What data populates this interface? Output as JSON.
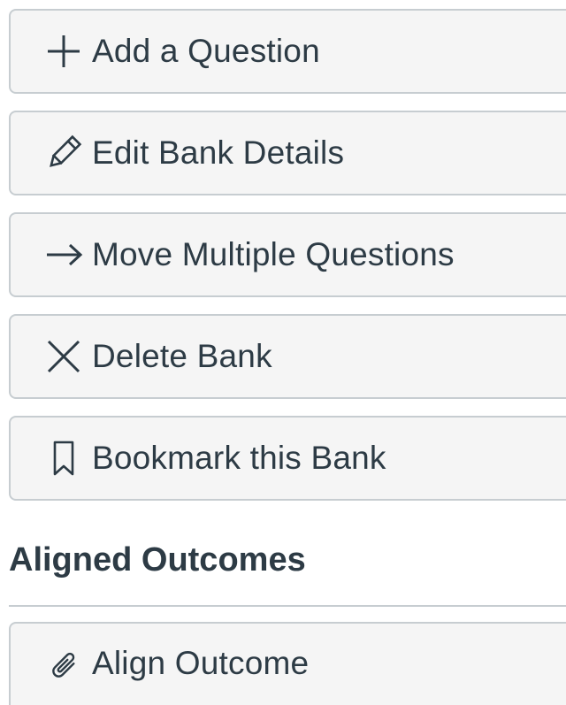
{
  "actions": {
    "add_question": {
      "label": "Add a Question",
      "icon": "plus-icon"
    },
    "edit_bank": {
      "label": "Edit Bank Details",
      "icon": "pencil-icon"
    },
    "move_questions": {
      "label": "Move Multiple Questions",
      "icon": "arrow-right-icon"
    },
    "delete_bank": {
      "label": "Delete Bank",
      "icon": "x-icon"
    },
    "bookmark_bank": {
      "label": "Bookmark this Bank",
      "icon": "bookmark-icon"
    }
  },
  "outcomes": {
    "heading": "Aligned Outcomes",
    "align_label": "Align Outcome",
    "align_icon": "paperclip-icon"
  },
  "colors": {
    "text": "#2d3b45",
    "button_bg": "#f5f5f5",
    "border": "#c7cdd1"
  }
}
